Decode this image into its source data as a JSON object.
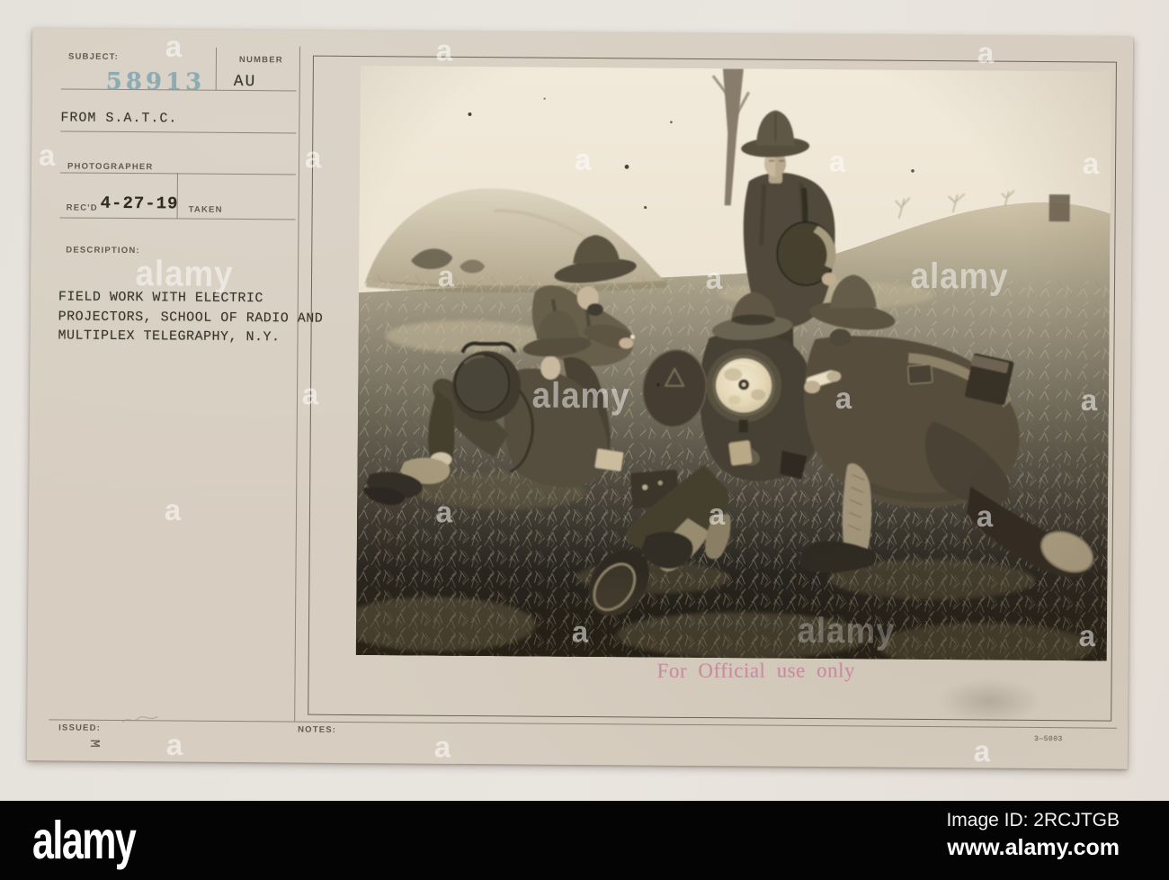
{
  "card": {
    "labels": {
      "subject": "SUBJECT:",
      "number": "NUMBER",
      "photographer": "PHOTOGRAPHER",
      "recd": "REC'D",
      "taken": "TAKEN",
      "description": "DESCRIPTION:",
      "issued": "ISSUED:",
      "notes": "NOTES:"
    },
    "fields": {
      "subject_number": "58913",
      "number_value": "AU",
      "from_line": "FROM S.A.T.C.",
      "recd_date": "4-27-19",
      "description_line1": "FIELD WORK WITH ELECTRIC",
      "description_line2": "PROJECTORS, SCHOOL OF RADIO AND",
      "description_line3": "MULTIPLEX TELEGRAPHY, N.Y.",
      "issued_mark": "M",
      "print_code": "3—5003"
    },
    "stamp": {
      "text": "For Official use only",
      "color": "#c57e99"
    },
    "subject_number_color": "#7fa6b3",
    "card_color": "#d7cec1"
  },
  "photo": {
    "subject": "field-work-with-electric-projectors",
    "palette": {
      "sky": "#eee6d6",
      "ground": "#bdb296",
      "uniform": "#4c4537",
      "reflector": "#f0e6cb"
    }
  },
  "watermark": {
    "glyph": "a",
    "word": "alamy"
  },
  "footer": {
    "logo": "alamy",
    "image_id": "Image ID: 2RCJTGB",
    "website": "www.alamy.com",
    "background": "#040404"
  }
}
